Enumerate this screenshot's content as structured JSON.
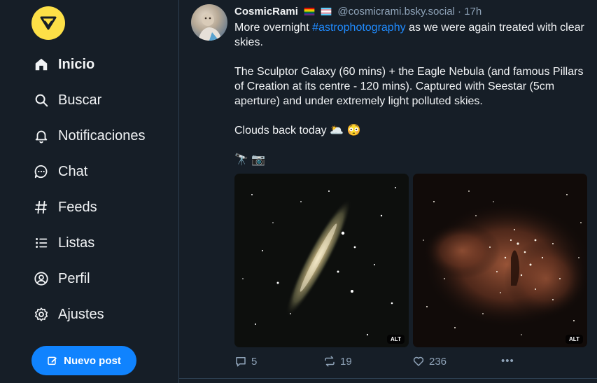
{
  "sidebar": {
    "items": [
      {
        "label": "Inicio",
        "icon": "home-icon"
      },
      {
        "label": "Buscar",
        "icon": "search-icon"
      },
      {
        "label": "Notificaciones",
        "icon": "bell-icon"
      },
      {
        "label": "Chat",
        "icon": "chat-icon"
      },
      {
        "label": "Feeds",
        "icon": "hash-icon"
      },
      {
        "label": "Listas",
        "icon": "list-icon"
      },
      {
        "label": "Perfil",
        "icon": "profile-icon"
      },
      {
        "label": "Ajustes",
        "icon": "gear-icon"
      }
    ],
    "new_post_label": "Nuevo post"
  },
  "post": {
    "author_name": "CosmicRami",
    "handle": "@cosmicrami.bsky.social",
    "separator": " · ",
    "time": "17h",
    "text_line1_pre": "More overnight ",
    "hashtag": "#astrophotography",
    "text_line1_post": " as we were again treated with clear skies.",
    "paragraph2": "The Sculptor Galaxy (60 mins) + the Eagle Nebula (and famous Pillars of Creation at its centre - 120 mins). Captured with Seestar (5cm aperture) and under extremely light polluted skies.",
    "paragraph3": "Clouds back today 🌥️ 😳",
    "paragraph4": "🔭 📷",
    "images": [
      {
        "alt_badge": "ALT"
      },
      {
        "alt_badge": "ALT"
      }
    ],
    "replies": "5",
    "reposts": "19",
    "likes": "236",
    "more": "•••"
  },
  "colors": {
    "background": "#161e27",
    "accent": "#1083fe",
    "hashtag": "#208bfe",
    "muted": "#8fa3b8",
    "logo": "#fde047"
  }
}
